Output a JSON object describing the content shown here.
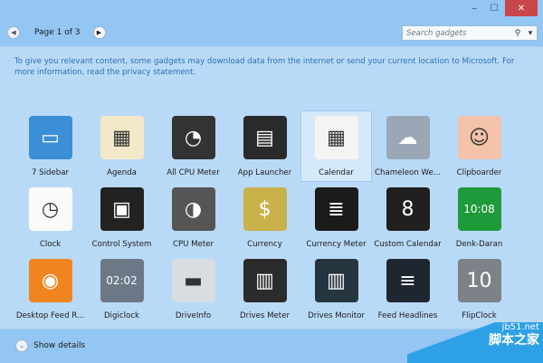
{
  "window": {
    "minimize": "‒",
    "maximize": "☐",
    "close": "✕"
  },
  "nav": {
    "prev": "◀",
    "next": "▶",
    "page": "Page 1 of 3"
  },
  "search": {
    "placeholder": "Search gadgets",
    "icon": "⚲",
    "dropdown": "▾"
  },
  "notice": "To give you relevant content, some gadgets may download data from the internet or send your current location to Microsoft. For more information, read the privacy statement.",
  "gadgets": [
    {
      "label": "7 Sidebar",
      "color": "#3a8fd6",
      "glyph": "▭"
    },
    {
      "label": "Agenda",
      "color": "#f3e9c8",
      "glyph": "▦"
    },
    {
      "label": "All CPU Meter",
      "color": "#333",
      "glyph": "◔"
    },
    {
      "label": "App Launcher",
      "color": "#2a2a2a",
      "glyph": "▤"
    },
    {
      "label": "Calendar",
      "color": "#f4f4f4",
      "glyph": "▦",
      "selected": true
    },
    {
      "label": "Chameleon We...",
      "color": "#9aa8b6",
      "glyph": "☁"
    },
    {
      "label": "Clipboarder",
      "color": "#f3c2a8",
      "glyph": "☺"
    },
    {
      "label": "Clock",
      "color": "#fafafa",
      "glyph": "◷"
    },
    {
      "label": "Control System",
      "color": "#222",
      "glyph": "▣"
    },
    {
      "label": "CPU Meter",
      "color": "#555",
      "glyph": "◑"
    },
    {
      "label": "Currency",
      "color": "#c9b24a",
      "glyph": "$"
    },
    {
      "label": "Currency Meter",
      "color": "#1b1b1b",
      "glyph": "≣"
    },
    {
      "label": "Custom Calendar",
      "color": "#202020",
      "glyph": "8"
    },
    {
      "label": "Denk-Daran",
      "color": "#1f9a3a",
      "glyph": "10:08"
    },
    {
      "label": "Desktop Feed R...",
      "color": "#f0841e",
      "glyph": "◉"
    },
    {
      "label": "Digiclock",
      "color": "#6c7886",
      "glyph": "02:02"
    },
    {
      "label": "DriveInfo",
      "color": "#d8dde2",
      "glyph": "▬"
    },
    {
      "label": "Drives Meter",
      "color": "#2b2b2b",
      "glyph": "▥"
    },
    {
      "label": "Drives Monitor",
      "color": "#253540",
      "glyph": "▥"
    },
    {
      "label": "Feed Headlines",
      "color": "#1e2630",
      "glyph": "≡"
    },
    {
      "label": "FlipClock",
      "color": "#7d8288",
      "glyph": "10"
    }
  ],
  "footer": {
    "show_details": "Show details",
    "chevron": "⌄"
  },
  "watermark": {
    "site": "jb51.net",
    "name": "脚本之家"
  }
}
